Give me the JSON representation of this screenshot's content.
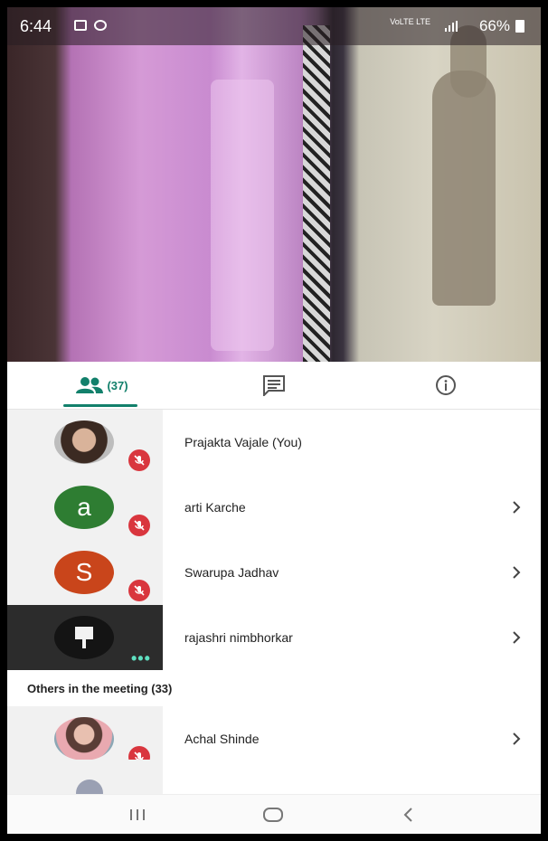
{
  "status_bar": {
    "time": "6:44",
    "network": "VoLTE LTE",
    "battery": "66%"
  },
  "tabs": {
    "people_count": "(37)",
    "accent": "#12806b"
  },
  "participants": [
    {
      "name": "Prajakta Vajale (You)",
      "avatar": "photo",
      "muted": true
    },
    {
      "name": "arti Karche",
      "avatar_letter": "a",
      "avatar_color": "#2e7d32",
      "muted": true
    },
    {
      "name": "Swarupa Jadhav",
      "avatar_letter": "S",
      "avatar_color": "#c9451b",
      "muted": true
    },
    {
      "name": "rajashri nimbhorkar",
      "avatar": "photo",
      "speaking": true
    }
  ],
  "others_section": {
    "title": "Others in the meeting (33)",
    "items": [
      {
        "name": "Achal Shinde",
        "avatar": "photo",
        "muted": true
      }
    ]
  },
  "icons": {
    "people": "people-icon",
    "chat": "chat-icon",
    "info": "info-icon",
    "mute": "mic-off-icon",
    "chevron": "chevron-right-icon",
    "nav_recents": "recents-icon",
    "nav_home": "home-icon",
    "nav_back": "back-icon"
  }
}
